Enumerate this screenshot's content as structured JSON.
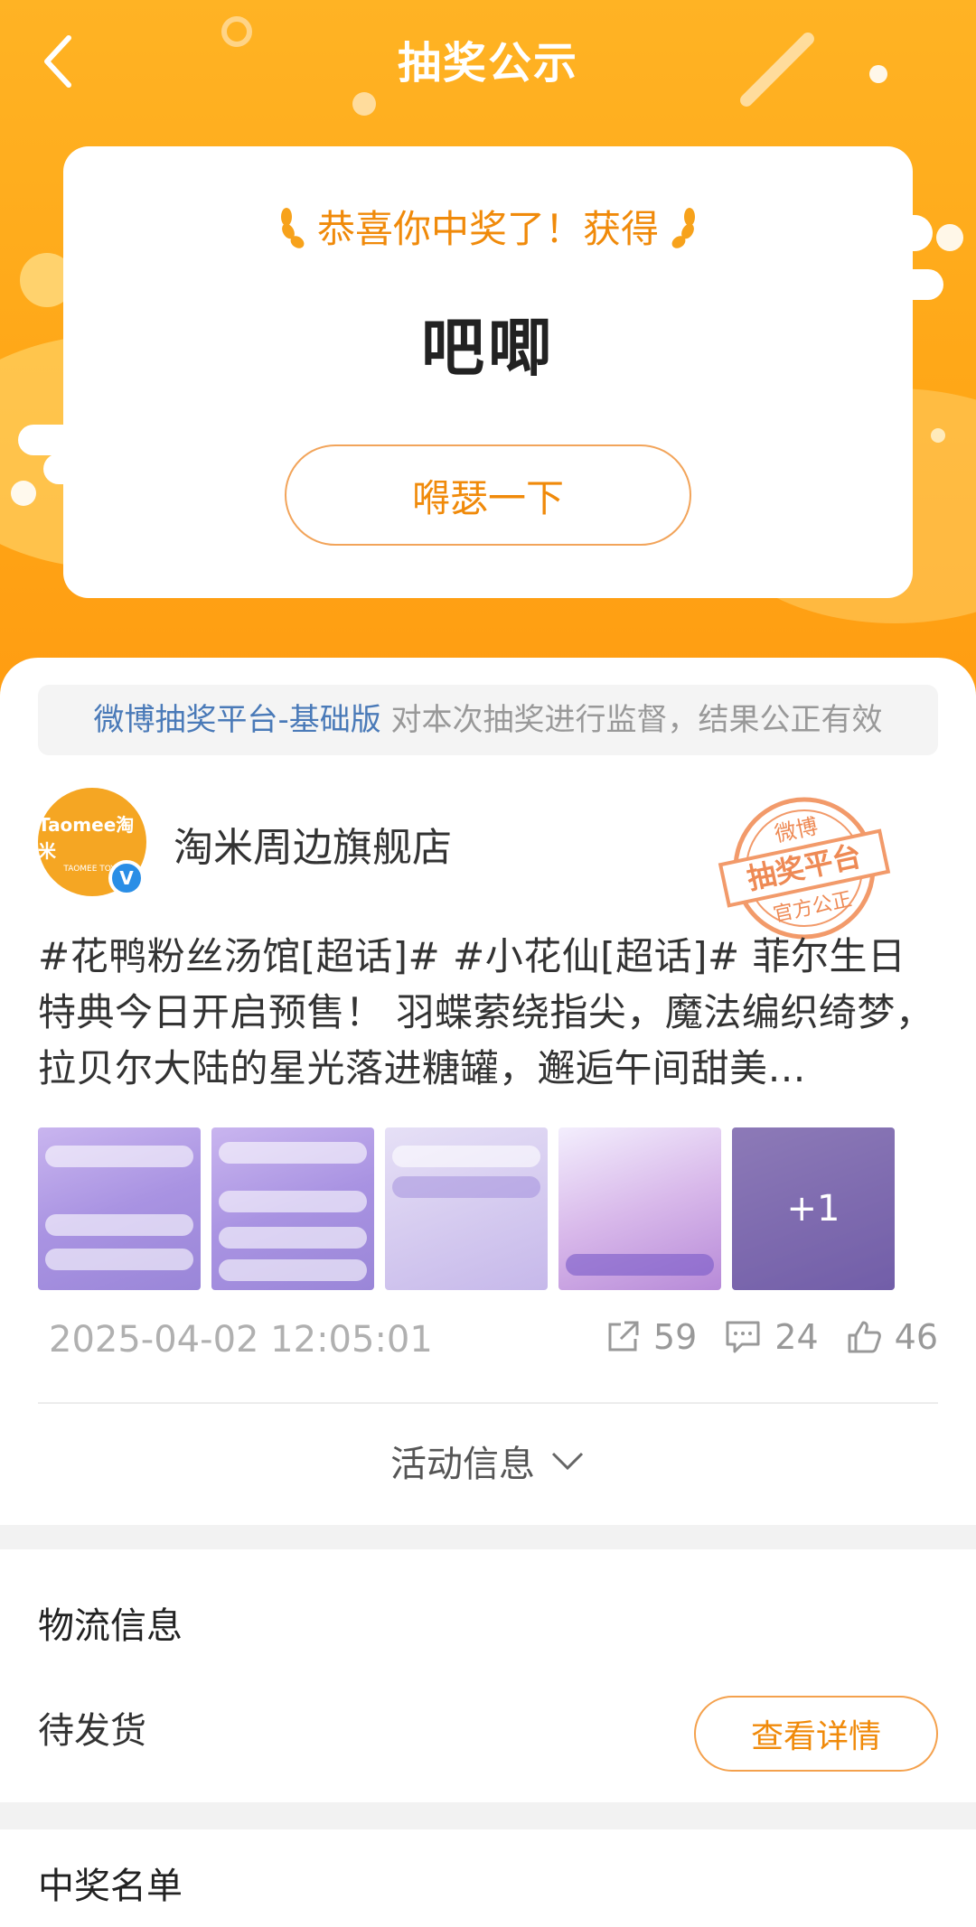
{
  "header": {
    "title": "抽奖公示",
    "back_icon": "chevron-left-icon"
  },
  "prize_card": {
    "congrats_text": "恭喜你中奖了！获得",
    "prize_name": "吧唧",
    "hype_button_label": "嘚瑟一下"
  },
  "notice": {
    "platform": "微博抽奖平台-基础版",
    "text": " 对本次抽奖进行监督，结果公正有效"
  },
  "post": {
    "shop_name": "淘米周边旗舰店",
    "avatar_logo": "Taomee淘米",
    "avatar_sub": "TAOMEE TOYS",
    "verify_badge": "V",
    "stamp": {
      "top": "微博",
      "main": "抽奖平台",
      "bottom": "官方公正"
    },
    "text": "#花鸭粉丝汤馆[超话]# #小花仙[超话]# 菲尔生日特典今日开启预售！ 羽蝶萦绕指尖，魔法编织绮梦，拉贝尔大陆的星光落进糖罐，邂逅午间甜美…",
    "more_images_label": "+1",
    "timestamp": "2025-04-02 12:05:01",
    "reposts": "59",
    "comments": "24",
    "likes": "46",
    "activity_info_label": "活动信息"
  },
  "logistics": {
    "title": "物流信息",
    "status": "待发货",
    "detail_button_label": "查看详情"
  },
  "winners": {
    "title": "中奖名单"
  },
  "colors": {
    "accent": "#f08a0a",
    "header": "#ffa616",
    "link": "#4a7ab8"
  }
}
